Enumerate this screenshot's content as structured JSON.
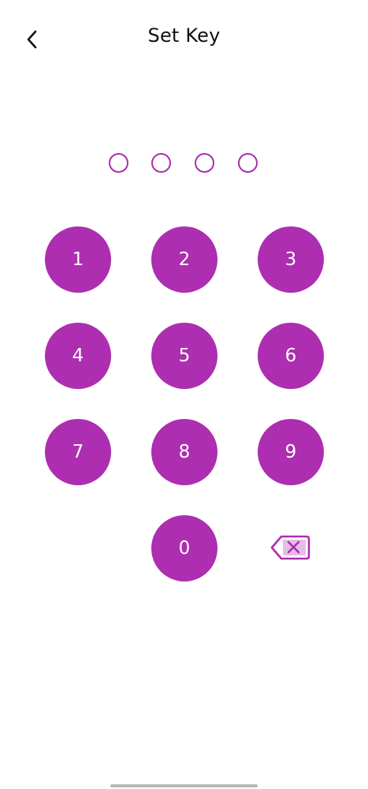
{
  "header": {
    "title": "Set Key",
    "back_icon": "chevron-left-icon"
  },
  "pin": {
    "length": 4,
    "filled": 0
  },
  "keypad": {
    "keys": [
      "1",
      "2",
      "3",
      "4",
      "5",
      "6",
      "7",
      "8",
      "9",
      "0"
    ],
    "delete_icon": "backspace-icon"
  },
  "colors": {
    "accent": "#ad2eb0",
    "dot_border": "#a92fae",
    "key_text": "#ffffff",
    "title_text": "#111111",
    "background": "#ffffff"
  }
}
